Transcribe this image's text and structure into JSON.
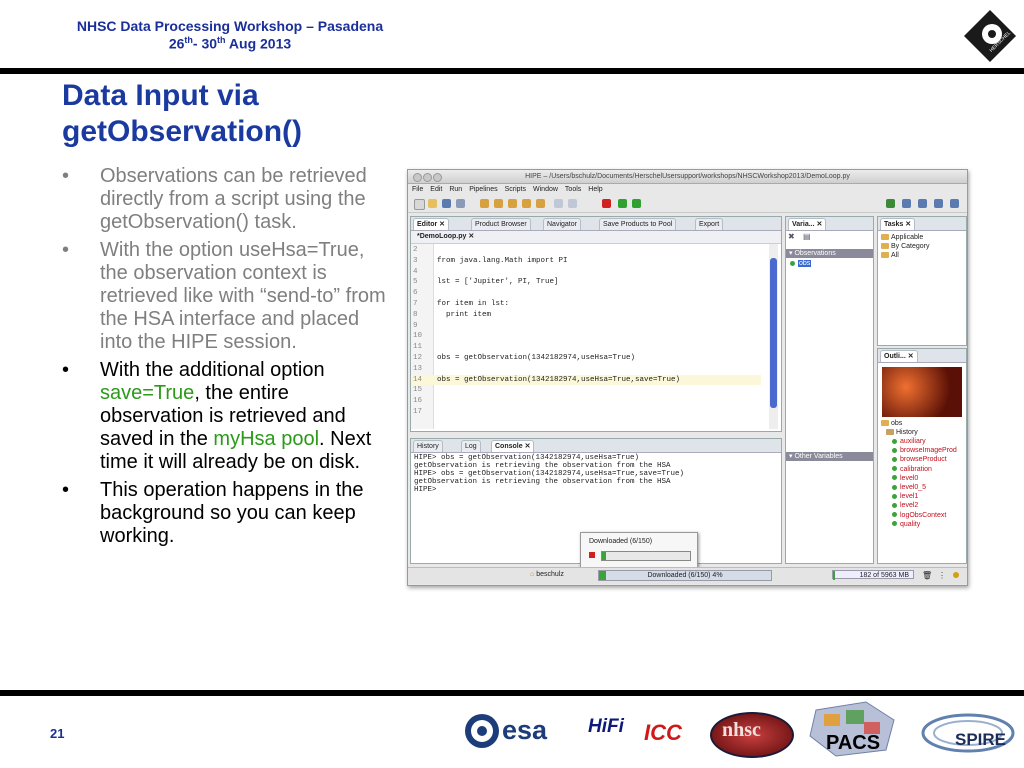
{
  "header": {
    "line1": "NHSC Data Processing Workshop – Pasadena",
    "date_a": "26",
    "sup_a": "th",
    "date_b": "- 30",
    "sup_b": "th",
    "date_c": " Aug 2013"
  },
  "title": {
    "line1": "Data Input via",
    "line2": "getObservation()"
  },
  "bullets": [
    {
      "marker": "•",
      "text": "Observations can be retrieved directly from a script using the getObservation() task."
    },
    {
      "marker": "•",
      "text": "With the option useHsa=True, the observation context is retrieved like with “send-to” from the HSA interface and placed into the HIPE session."
    },
    {
      "marker": "•",
      "part1": "With the additional option ",
      "part2": "save=True",
      "part3": ", the entire observation is retrieved and saved in the ",
      "part4": "myHsa pool",
      "part5": ". Next time it will already be on disk."
    },
    {
      "marker": "•",
      "text": "This operation happens in the background so you can keep working."
    }
  ],
  "page_number": "21",
  "window": {
    "title": "HIPE – /Users/bschulz/Documents/HerschelUsersupport/workshops/NHSCWorkshop2013/DemoLoop.py",
    "menu": [
      "File",
      "Edit",
      "Run",
      "Pipelines",
      "Scripts",
      "Window",
      "Tools",
      "Help"
    ],
    "editor_tabs": [
      "Editor",
      "Product Browser",
      "Navigator",
      "Save Products to Pool",
      "Export"
    ],
    "file_tab": "*DemoLoop.py",
    "code": [
      {
        "n": "2",
        "t": ""
      },
      {
        "n": "3",
        "t": "from java.lang.Math import PI"
      },
      {
        "n": "4",
        "t": ""
      },
      {
        "n": "5",
        "t": "lst = ['Jupiter', PI, True]"
      },
      {
        "n": "6",
        "t": ""
      },
      {
        "n": "7",
        "t": "for item in lst:"
      },
      {
        "n": "8",
        "t": "  print item"
      },
      {
        "n": "9",
        "t": ""
      },
      {
        "n": "10",
        "t": ""
      },
      {
        "n": "11",
        "t": ""
      },
      {
        "n": "12",
        "t": "obs = getObservation(1342182974,useHsa=True)"
      },
      {
        "n": "13",
        "t": ""
      },
      {
        "n": "14",
        "t": "obs = getObservation(1342182974,useHsa=True,save=True)"
      },
      {
        "n": "15",
        "t": ""
      },
      {
        "n": "16",
        "t": ""
      },
      {
        "n": "17",
        "t": ""
      }
    ],
    "variables_tab": "Varia...",
    "observations_label": "Observations",
    "obs_item": "obs",
    "other_variables": "Other Variables",
    "tasks_tab": "Tasks",
    "tasks_items": [
      "Applicable",
      "By Category",
      "All"
    ],
    "outline_tab": "Outli...",
    "outline_root": "obs",
    "outline_history": "History",
    "outline_items": [
      "auxiliary",
      "browseImageProd",
      "browseProduct",
      "calibration",
      "level0",
      "level0_5",
      "level1",
      "level2",
      "logObsContext",
      "quality"
    ],
    "console_tabs": [
      "History",
      "Log",
      "Console"
    ],
    "console_lines": [
      "HIPE> obs = getObservation(1342182974,useHsa=True)",
      "getObservation is retrieving the observation from the HSA",
      "HIPE> obs = getObservation(1342182974,useHsa=True,save=True)",
      "getObservation is retrieving the observation from the HSA",
      "HIPE>"
    ],
    "popup_label": "Downloaded (6/150)",
    "popup_progress": 0.04,
    "status_user": "beschulz",
    "status_download": "Downloaded (6/150) 4%",
    "status_memory": "182 of 5963 MB",
    "memory_fraction": 0.03
  },
  "logos": {
    "esa": "esa",
    "hifi": "HiFi",
    "icc": "ICC",
    "nhsc": "nhsc",
    "pacs": "PACS",
    "spire": "SPIRE",
    "herschel": "HERSCHEL"
  },
  "colors": {
    "header_blue": "#1a2f9a",
    "title_blue": "#1a3aa0",
    "gray_text": "#7f7f7f",
    "highlight_green": "#2a9a18"
  }
}
